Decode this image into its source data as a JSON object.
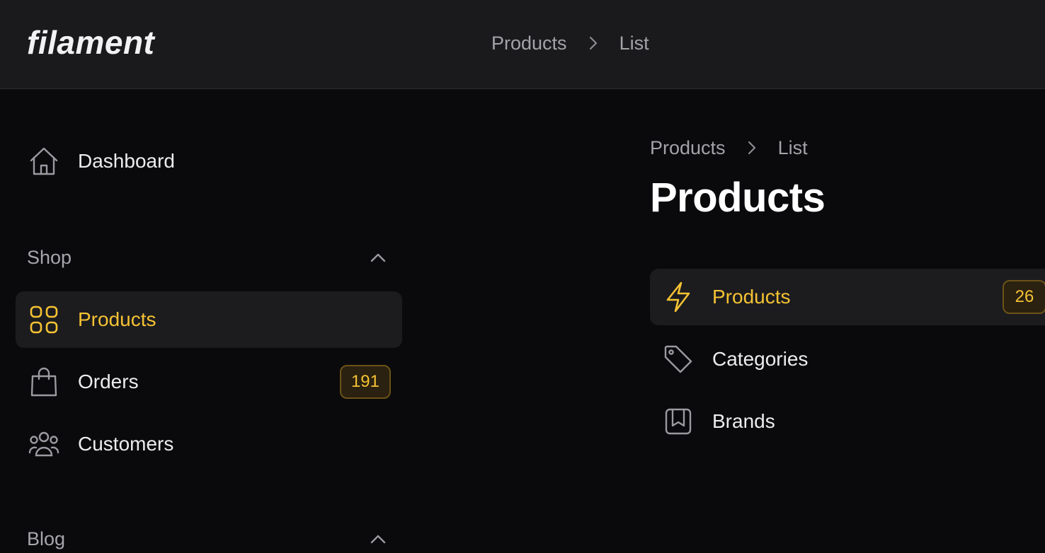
{
  "app": {
    "logo_text": "filament"
  },
  "header": {
    "breadcrumbs": [
      "Products",
      "List"
    ]
  },
  "sidebar": {
    "items": [
      {
        "label": "Dashboard",
        "icon": "home-icon"
      }
    ],
    "groups": [
      {
        "label": "Shop",
        "expanded": true,
        "items": [
          {
            "label": "Products",
            "icon": "squares-icon",
            "active": true
          },
          {
            "label": "Orders",
            "icon": "shopping-bag-icon",
            "badge": "191"
          },
          {
            "label": "Customers",
            "icon": "users-icon"
          }
        ]
      },
      {
        "label": "Blog",
        "expanded": true
      }
    ]
  },
  "main": {
    "breadcrumbs": [
      "Products",
      "List"
    ],
    "title": "Products",
    "sub_navigation": [
      {
        "label": "Products",
        "icon": "bolt-icon",
        "active": true,
        "badge": "26"
      },
      {
        "label": "Categories",
        "icon": "tag-icon"
      },
      {
        "label": "Brands",
        "icon": "bookmark-square-icon"
      }
    ]
  },
  "colors": {
    "accent": "#f5c233",
    "background": "#0a0a0c",
    "topbar": "#1a1a1c",
    "active_bg": "#1c1c1f"
  }
}
